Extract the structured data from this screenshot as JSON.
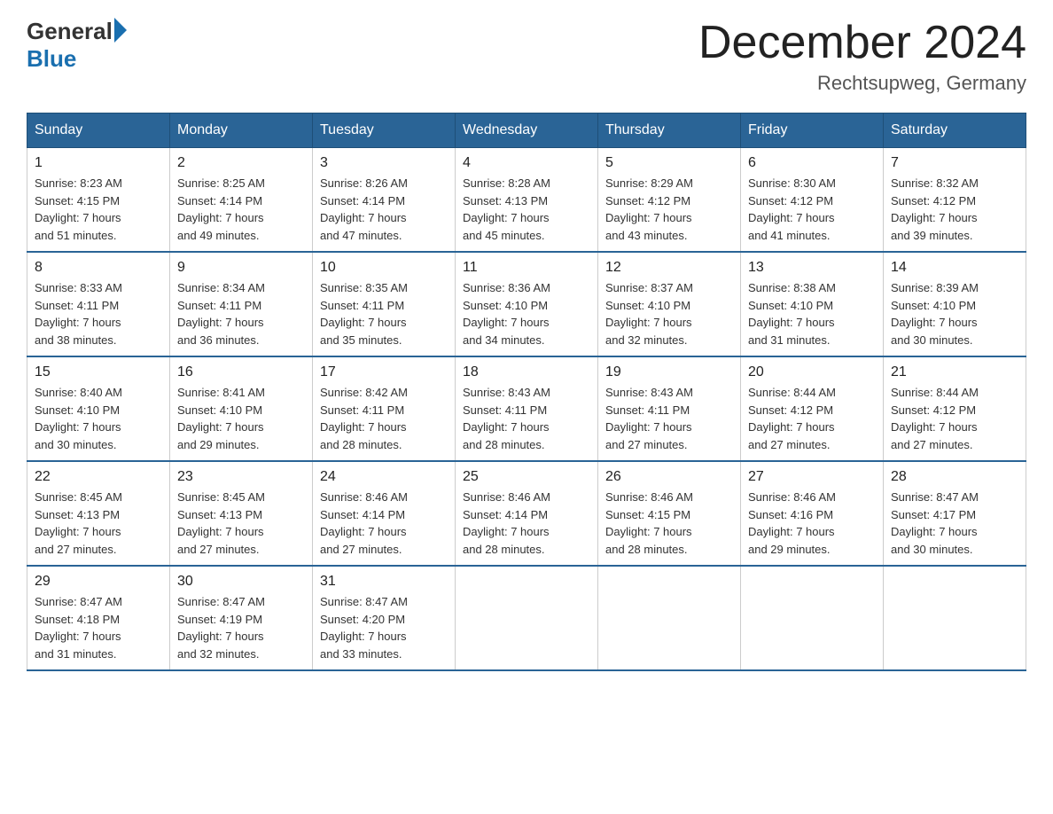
{
  "logo": {
    "general": "General",
    "blue": "Blue"
  },
  "header": {
    "month": "December 2024",
    "location": "Rechtsupweg, Germany"
  },
  "weekdays": [
    "Sunday",
    "Monday",
    "Tuesday",
    "Wednesday",
    "Thursday",
    "Friday",
    "Saturday"
  ],
  "weeks": [
    [
      {
        "day": "1",
        "sunrise": "8:23 AM",
        "sunset": "4:15 PM",
        "daylight": "7 hours and 51 minutes."
      },
      {
        "day": "2",
        "sunrise": "8:25 AM",
        "sunset": "4:14 PM",
        "daylight": "7 hours and 49 minutes."
      },
      {
        "day": "3",
        "sunrise": "8:26 AM",
        "sunset": "4:14 PM",
        "daylight": "7 hours and 47 minutes."
      },
      {
        "day": "4",
        "sunrise": "8:28 AM",
        "sunset": "4:13 PM",
        "daylight": "7 hours and 45 minutes."
      },
      {
        "day": "5",
        "sunrise": "8:29 AM",
        "sunset": "4:12 PM",
        "daylight": "7 hours and 43 minutes."
      },
      {
        "day": "6",
        "sunrise": "8:30 AM",
        "sunset": "4:12 PM",
        "daylight": "7 hours and 41 minutes."
      },
      {
        "day": "7",
        "sunrise": "8:32 AM",
        "sunset": "4:12 PM",
        "daylight": "7 hours and 39 minutes."
      }
    ],
    [
      {
        "day": "8",
        "sunrise": "8:33 AM",
        "sunset": "4:11 PM",
        "daylight": "7 hours and 38 minutes."
      },
      {
        "day": "9",
        "sunrise": "8:34 AM",
        "sunset": "4:11 PM",
        "daylight": "7 hours and 36 minutes."
      },
      {
        "day": "10",
        "sunrise": "8:35 AM",
        "sunset": "4:11 PM",
        "daylight": "7 hours and 35 minutes."
      },
      {
        "day": "11",
        "sunrise": "8:36 AM",
        "sunset": "4:10 PM",
        "daylight": "7 hours and 34 minutes."
      },
      {
        "day": "12",
        "sunrise": "8:37 AM",
        "sunset": "4:10 PM",
        "daylight": "7 hours and 32 minutes."
      },
      {
        "day": "13",
        "sunrise": "8:38 AM",
        "sunset": "4:10 PM",
        "daylight": "7 hours and 31 minutes."
      },
      {
        "day": "14",
        "sunrise": "8:39 AM",
        "sunset": "4:10 PM",
        "daylight": "7 hours and 30 minutes."
      }
    ],
    [
      {
        "day": "15",
        "sunrise": "8:40 AM",
        "sunset": "4:10 PM",
        "daylight": "7 hours and 30 minutes."
      },
      {
        "day": "16",
        "sunrise": "8:41 AM",
        "sunset": "4:10 PM",
        "daylight": "7 hours and 29 minutes."
      },
      {
        "day": "17",
        "sunrise": "8:42 AM",
        "sunset": "4:11 PM",
        "daylight": "7 hours and 28 minutes."
      },
      {
        "day": "18",
        "sunrise": "8:43 AM",
        "sunset": "4:11 PM",
        "daylight": "7 hours and 28 minutes."
      },
      {
        "day": "19",
        "sunrise": "8:43 AM",
        "sunset": "4:11 PM",
        "daylight": "7 hours and 27 minutes."
      },
      {
        "day": "20",
        "sunrise": "8:44 AM",
        "sunset": "4:12 PM",
        "daylight": "7 hours and 27 minutes."
      },
      {
        "day": "21",
        "sunrise": "8:44 AM",
        "sunset": "4:12 PM",
        "daylight": "7 hours and 27 minutes."
      }
    ],
    [
      {
        "day": "22",
        "sunrise": "8:45 AM",
        "sunset": "4:13 PM",
        "daylight": "7 hours and 27 minutes."
      },
      {
        "day": "23",
        "sunrise": "8:45 AM",
        "sunset": "4:13 PM",
        "daylight": "7 hours and 27 minutes."
      },
      {
        "day": "24",
        "sunrise": "8:46 AM",
        "sunset": "4:14 PM",
        "daylight": "7 hours and 27 minutes."
      },
      {
        "day": "25",
        "sunrise": "8:46 AM",
        "sunset": "4:14 PM",
        "daylight": "7 hours and 28 minutes."
      },
      {
        "day": "26",
        "sunrise": "8:46 AM",
        "sunset": "4:15 PM",
        "daylight": "7 hours and 28 minutes."
      },
      {
        "day": "27",
        "sunrise": "8:46 AM",
        "sunset": "4:16 PM",
        "daylight": "7 hours and 29 minutes."
      },
      {
        "day": "28",
        "sunrise": "8:47 AM",
        "sunset": "4:17 PM",
        "daylight": "7 hours and 30 minutes."
      }
    ],
    [
      {
        "day": "29",
        "sunrise": "8:47 AM",
        "sunset": "4:18 PM",
        "daylight": "7 hours and 31 minutes."
      },
      {
        "day": "30",
        "sunrise": "8:47 AM",
        "sunset": "4:19 PM",
        "daylight": "7 hours and 32 minutes."
      },
      {
        "day": "31",
        "sunrise": "8:47 AM",
        "sunset": "4:20 PM",
        "daylight": "7 hours and 33 minutes."
      },
      null,
      null,
      null,
      null
    ]
  ],
  "labels": {
    "sunrise": "Sunrise:",
    "sunset": "Sunset:",
    "daylight": "Daylight:"
  }
}
